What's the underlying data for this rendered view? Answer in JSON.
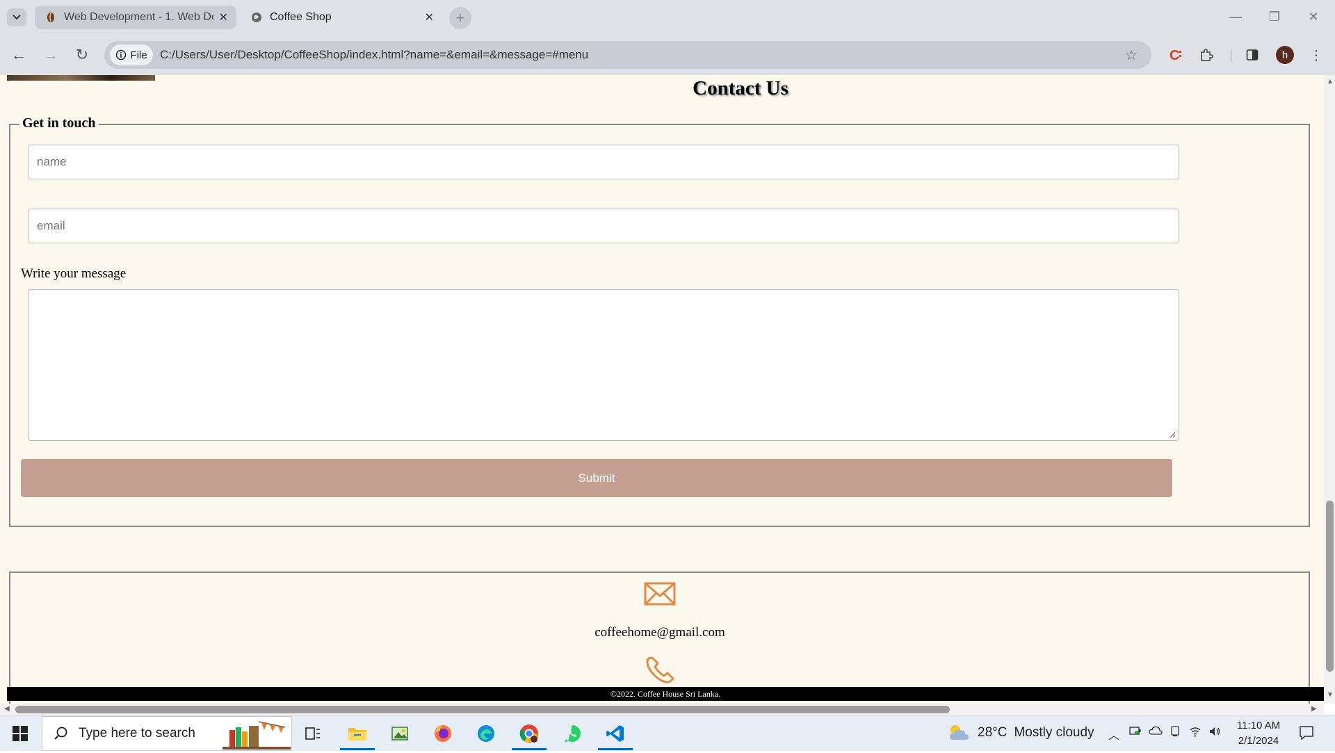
{
  "browser": {
    "tabs": [
      {
        "title": "Web Development - 1. Web De",
        "active": false
      },
      {
        "title": "Coffee Shop",
        "active": true
      }
    ],
    "new_tab_label": "+",
    "file_chip": "File",
    "url": "C:/Users/User/Desktop/CoffeeShop/index.html?name=&email=&message=#menu",
    "profile_initial": "h"
  },
  "page": {
    "contact_title": "Contact Us",
    "legend": "Get in touch",
    "name_placeholder": "name",
    "email_placeholder": "email",
    "message_label": "Write your message",
    "submit_label": "Submit",
    "contact_email": "coffeehome@gmail.com",
    "footer_text": "©2022. Coffee House Sri Lanka.",
    "accent_color": "#e08a45",
    "button_color": "#c5a092",
    "background_color": "#fdf8ee"
  },
  "taskbar": {
    "search_placeholder": "Type here to search",
    "weather_temp": "28°C",
    "weather_desc": "Mostly cloudy",
    "time": "11:10 AM",
    "date": "2/1/2024",
    "apps": [
      "task-view",
      "file-explorer",
      "image-app",
      "firefox",
      "edge",
      "chrome",
      "whatsapp",
      "vscode"
    ]
  }
}
